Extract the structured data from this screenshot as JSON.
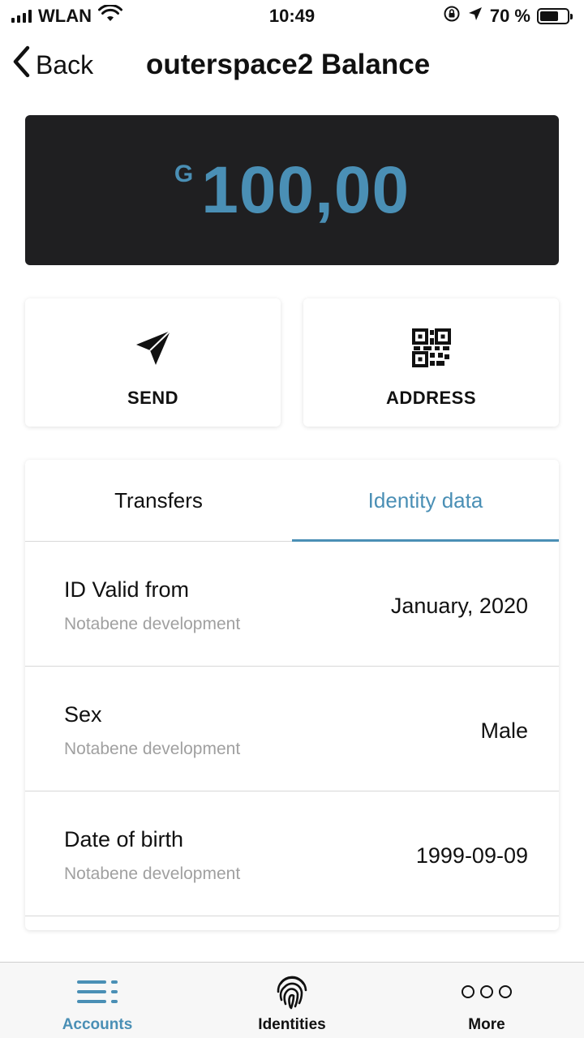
{
  "status_bar": {
    "carrier": "WLAN",
    "time": "10:49",
    "battery_percent": "70 %"
  },
  "nav": {
    "back_label": "Back",
    "title": "outerspace2 Balance"
  },
  "balance": {
    "currency_symbol": "G",
    "amount": "100,00"
  },
  "actions": {
    "send_label": "SEND",
    "address_label": "ADDRESS"
  },
  "tabs": [
    {
      "label": "Transfers"
    },
    {
      "label": "Identity data"
    }
  ],
  "identity_rows": [
    {
      "label": "ID Valid from",
      "source": "Notabene development",
      "value": "January, 2020"
    },
    {
      "label": "Sex",
      "source": "Notabene development",
      "value": "Male"
    },
    {
      "label": "Date of birth",
      "source": "Notabene development",
      "value": "1999-09-09"
    }
  ],
  "tab_bar": {
    "accounts_label": "Accounts",
    "identities_label": "Identities",
    "more_label": "More"
  },
  "colors": {
    "accent": "#4a8fb5",
    "card_dark": "#1f1f21"
  }
}
